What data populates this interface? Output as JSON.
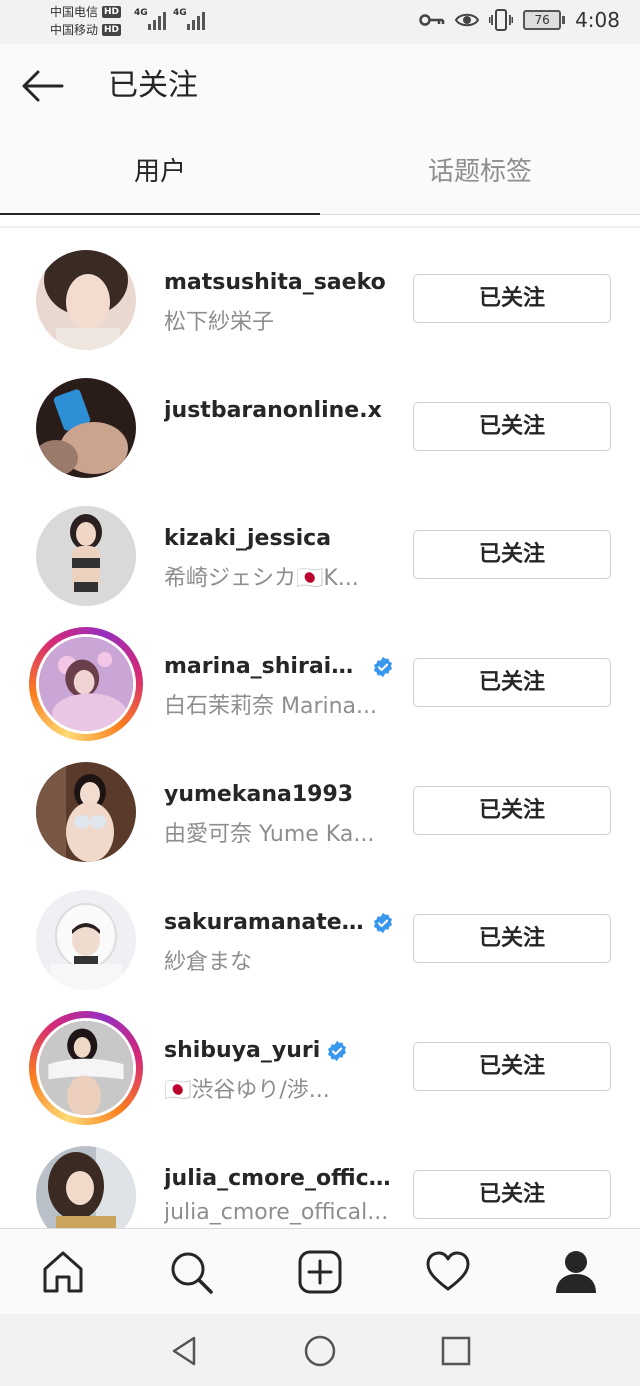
{
  "status_bar": {
    "carrier1": "中国电信",
    "carrier2": "中国移动",
    "hd_badge": "HD",
    "network1": "4G",
    "network2": "4G",
    "battery_level": "76",
    "time": "4:08",
    "icons": [
      "key-icon",
      "eye-icon",
      "vibrate-icon",
      "battery-icon"
    ]
  },
  "header": {
    "title": "已关注",
    "back_icon": "arrow-left-icon"
  },
  "tabs": [
    {
      "label": "用户",
      "active": true
    },
    {
      "label": "话题标签",
      "active": false
    }
  ],
  "users": [
    {
      "username": "matsushita_saeko",
      "fullname": "松下紗栄子",
      "verified": false,
      "story": false,
      "button": "已关注"
    },
    {
      "username": "justbaranonline.x",
      "fullname": "",
      "verified": false,
      "story": false,
      "button": "已关注"
    },
    {
      "username": "kizaki_jessica",
      "fullname": "希崎ジェシカ🇯🇵K...",
      "verified": false,
      "story": false,
      "button": "已关注"
    },
    {
      "username": "marina_shirais...",
      "fullname": "白石茉莉奈 Marina...",
      "verified": true,
      "story": true,
      "button": "已关注"
    },
    {
      "username": "yumekana1993",
      "fullname": "由愛可奈  Yume Ka...",
      "verified": false,
      "story": false,
      "button": "已关注"
    },
    {
      "username": "sakuramanateee",
      "fullname": "紗倉まな",
      "verified": true,
      "story": false,
      "button": "已关注"
    },
    {
      "username": "shibuya_yuri",
      "fullname": "🇯🇵渋谷ゆり/渉...",
      "verified": true,
      "story": true,
      "button": "已关注"
    },
    {
      "username": "julia_cmore_official",
      "fullname": "julia_cmore_offical...",
      "verified": false,
      "story": false,
      "button": "已关注"
    }
  ],
  "bottom_nav": [
    "home-icon",
    "search-icon",
    "add-post-icon",
    "heart-icon",
    "profile-icon"
  ],
  "system_nav": [
    "back-triangle-icon",
    "home-circle-icon",
    "recents-square-icon"
  ],
  "colors": {
    "text": "#262626",
    "secondary": "#8e8e8e",
    "verified": "#3897f0",
    "border": "#dbdbdb"
  }
}
